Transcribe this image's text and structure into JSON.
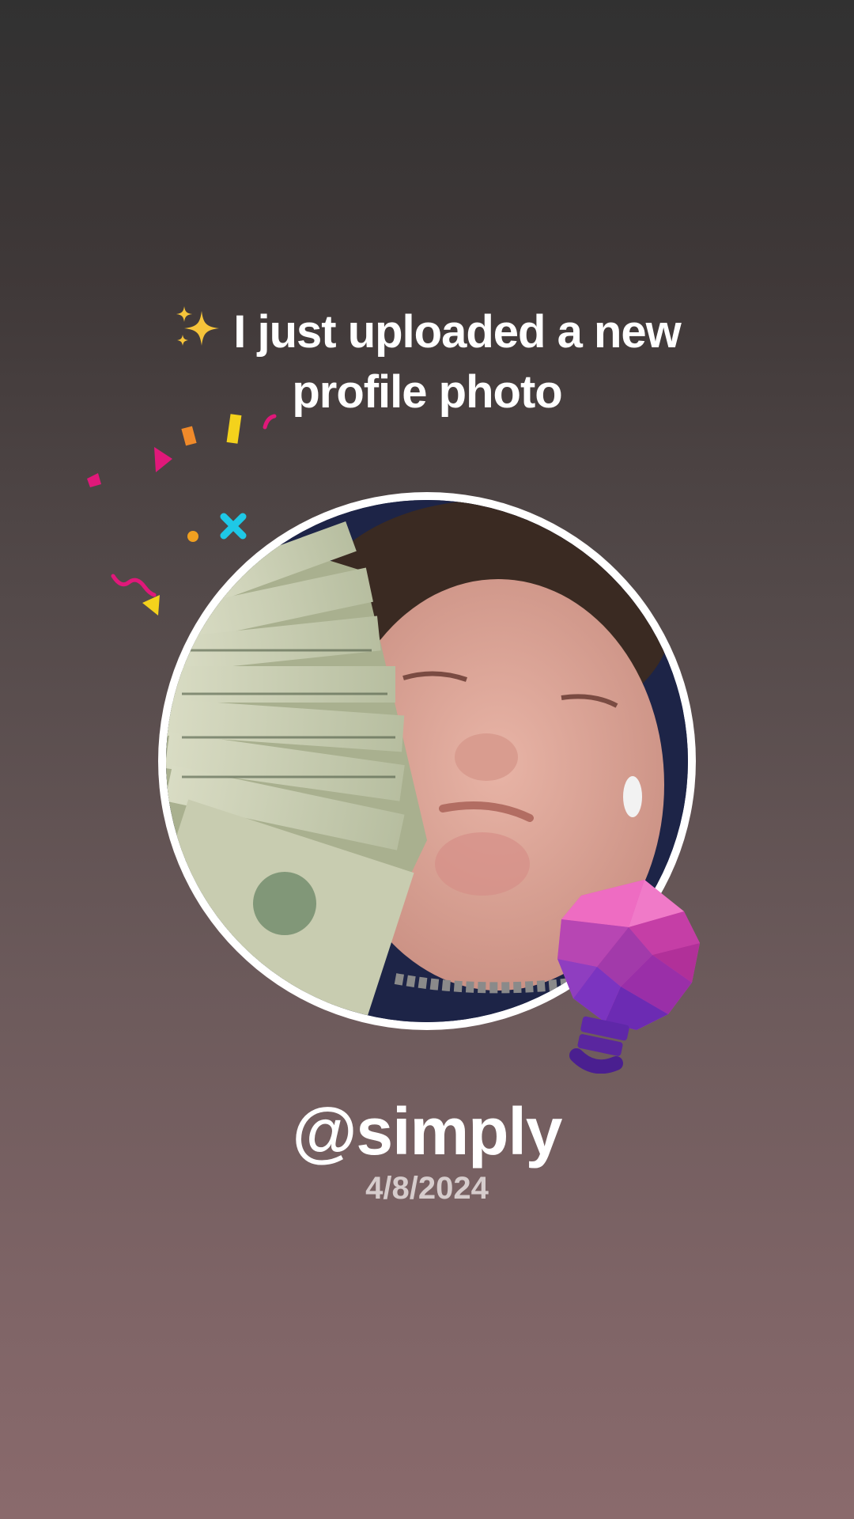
{
  "post": {
    "sparkle_icon": "sparkles-icon",
    "headline": "I just uploaded a new profile photo",
    "username": "@simply",
    "date": "4/8/2024"
  },
  "avatar": {
    "image": "profile-photo",
    "badge_icon": "lightbulb-icon"
  },
  "colors": {
    "text": "#ffffff",
    "date_text": "#d6cccc",
    "ring": "#ffffff",
    "bulb_pink": "#e44fb0",
    "bulb_purple": "#7b2fbe",
    "background_top": "#313131",
    "background_bottom": "#8a6a6c"
  }
}
